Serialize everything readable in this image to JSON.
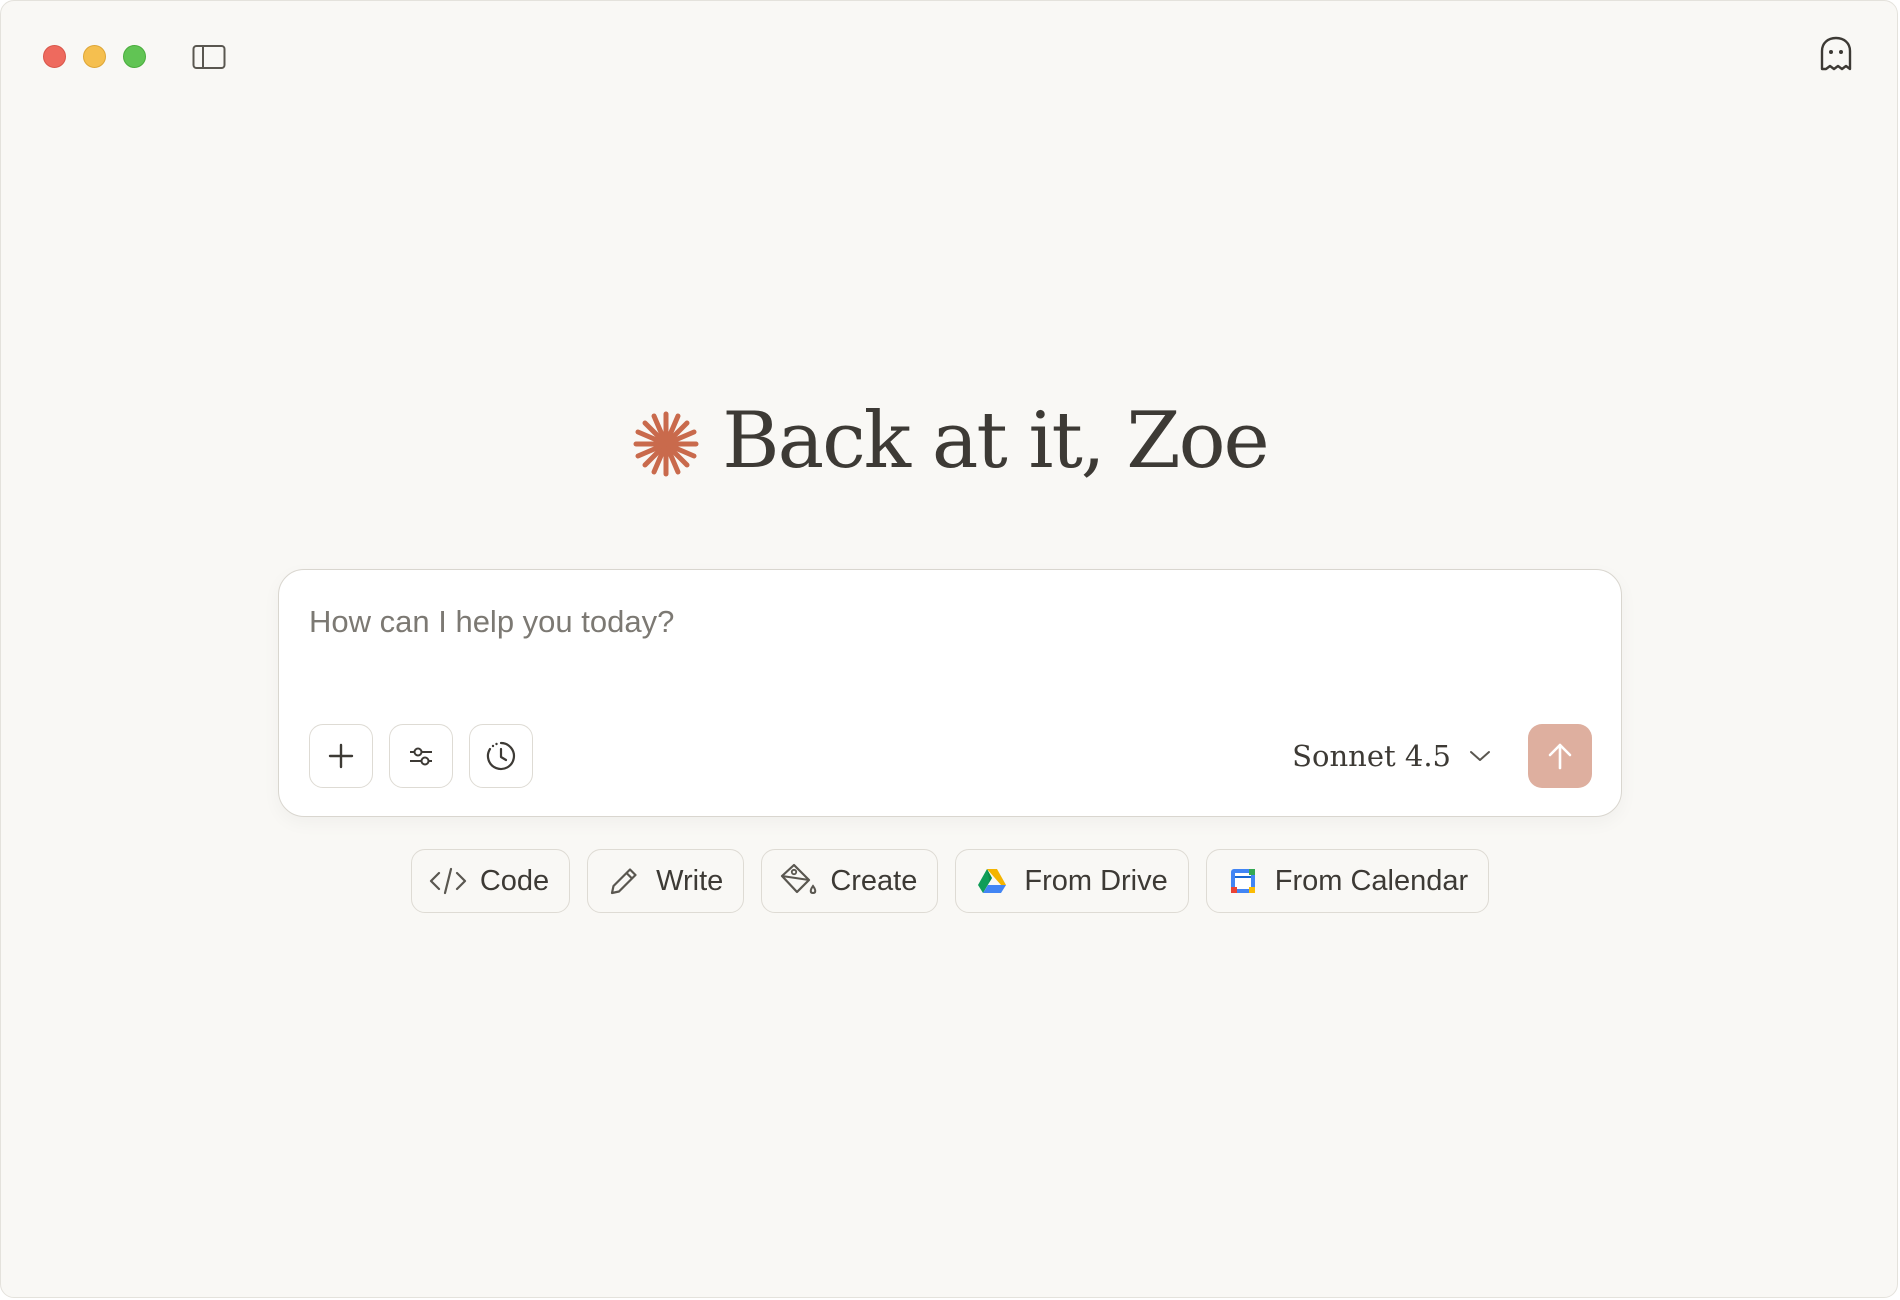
{
  "window": {
    "background": "#f9f8f5"
  },
  "titlebar": {
    "sidebar_toggle_icon": "sidebar-icon",
    "right_icon": "ghost-icon"
  },
  "greeting": {
    "icon": "sparkle-icon",
    "accent_color": "#c96a4c",
    "text": "Back at it, Zoe"
  },
  "composer": {
    "placeholder": "How can I help you today?",
    "value": "",
    "tools": [
      {
        "name": "add",
        "icon": "plus-icon"
      },
      {
        "name": "settings",
        "icon": "sliders-icon"
      },
      {
        "name": "history",
        "icon": "clock-icon"
      }
    ],
    "model": {
      "label": "Sonnet 4.5",
      "icon": "chevron-down-icon"
    },
    "send": {
      "icon": "arrow-up-icon",
      "color": "#deaf9f"
    }
  },
  "chips": [
    {
      "label": "Code",
      "icon": "code-icon"
    },
    {
      "label": "Write",
      "icon": "pencil-icon"
    },
    {
      "label": "Create",
      "icon": "paint-bucket-icon"
    },
    {
      "label": "From Drive",
      "icon": "google-drive-icon"
    },
    {
      "label": "From Calendar",
      "icon": "google-calendar-icon"
    }
  ]
}
